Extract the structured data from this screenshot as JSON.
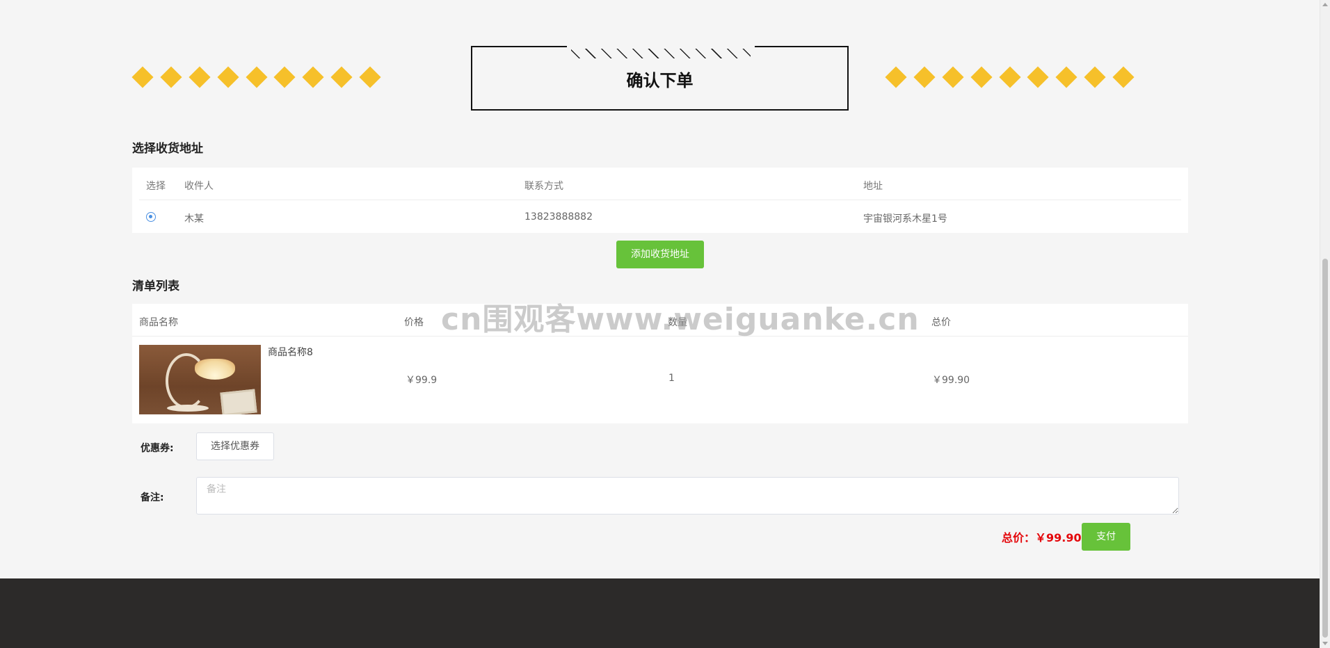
{
  "page": {
    "title": "确认下单",
    "watermark": "cn围观客www.weiguanke.cn"
  },
  "address": {
    "section_title": "选择收货地址",
    "columns": [
      "选择",
      "收件人",
      "联系方式",
      "地址"
    ],
    "rows": [
      {
        "selected": true,
        "recipient": "木某",
        "phone": "13823888882",
        "address": "宇宙银河系木星1号"
      }
    ],
    "add_button": "添加收货地址"
  },
  "order_list": {
    "section_title": "清单列表",
    "columns": [
      "商品名称",
      "价格",
      "数量",
      "总价"
    ],
    "rows": [
      {
        "image": "table-lamp-photo",
        "name": "商品名称8",
        "price": "￥99.9",
        "quantity": "1",
        "subtotal": "￥99.90"
      }
    ]
  },
  "form": {
    "coupon_label": "优惠券:",
    "coupon_button": "选择优惠券",
    "remark_label": "备注:",
    "remark_placeholder": "备注",
    "remark_value": ""
  },
  "summary": {
    "total_text": "总价：￥99.90",
    "pay_button": "支付"
  },
  "colors": {
    "accent_green": "#67c23a",
    "diamond_yellow": "#f6c02a",
    "total_red": "#e4060a",
    "footer": "#2c2a29",
    "radio_blue": "#4a90e2"
  }
}
